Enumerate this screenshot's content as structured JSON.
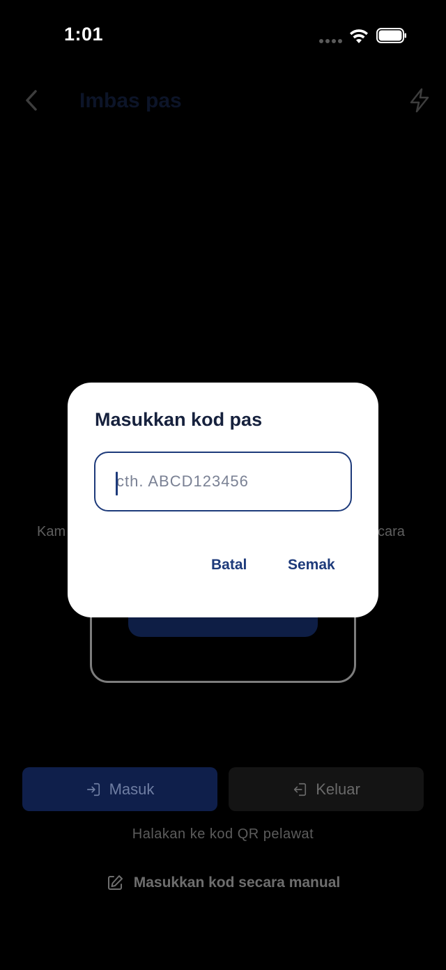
{
  "status_bar": {
    "time": "1:01"
  },
  "nav": {
    "title": "Imbas pas"
  },
  "background": {
    "text_left": "Kam",
    "text_right": "cara",
    "modes": [
      {
        "label": "Masuk",
        "icon": "login-icon"
      },
      {
        "label": "Keluar",
        "icon": "logout-icon"
      }
    ],
    "hint": "Halakan ke kod QR pelawat",
    "manual_entry": "Masukkan kod secara manual"
  },
  "dialog": {
    "title": "Masukkan kod pas",
    "input_value": "",
    "input_placeholder": "cth. ABCD123456",
    "cancel_label": "Batal",
    "check_label": "Semak"
  },
  "colors": {
    "accent": "#1d3a7a",
    "dialog_bg": "#ffffff",
    "dim_primary": "#0f1f4b"
  }
}
